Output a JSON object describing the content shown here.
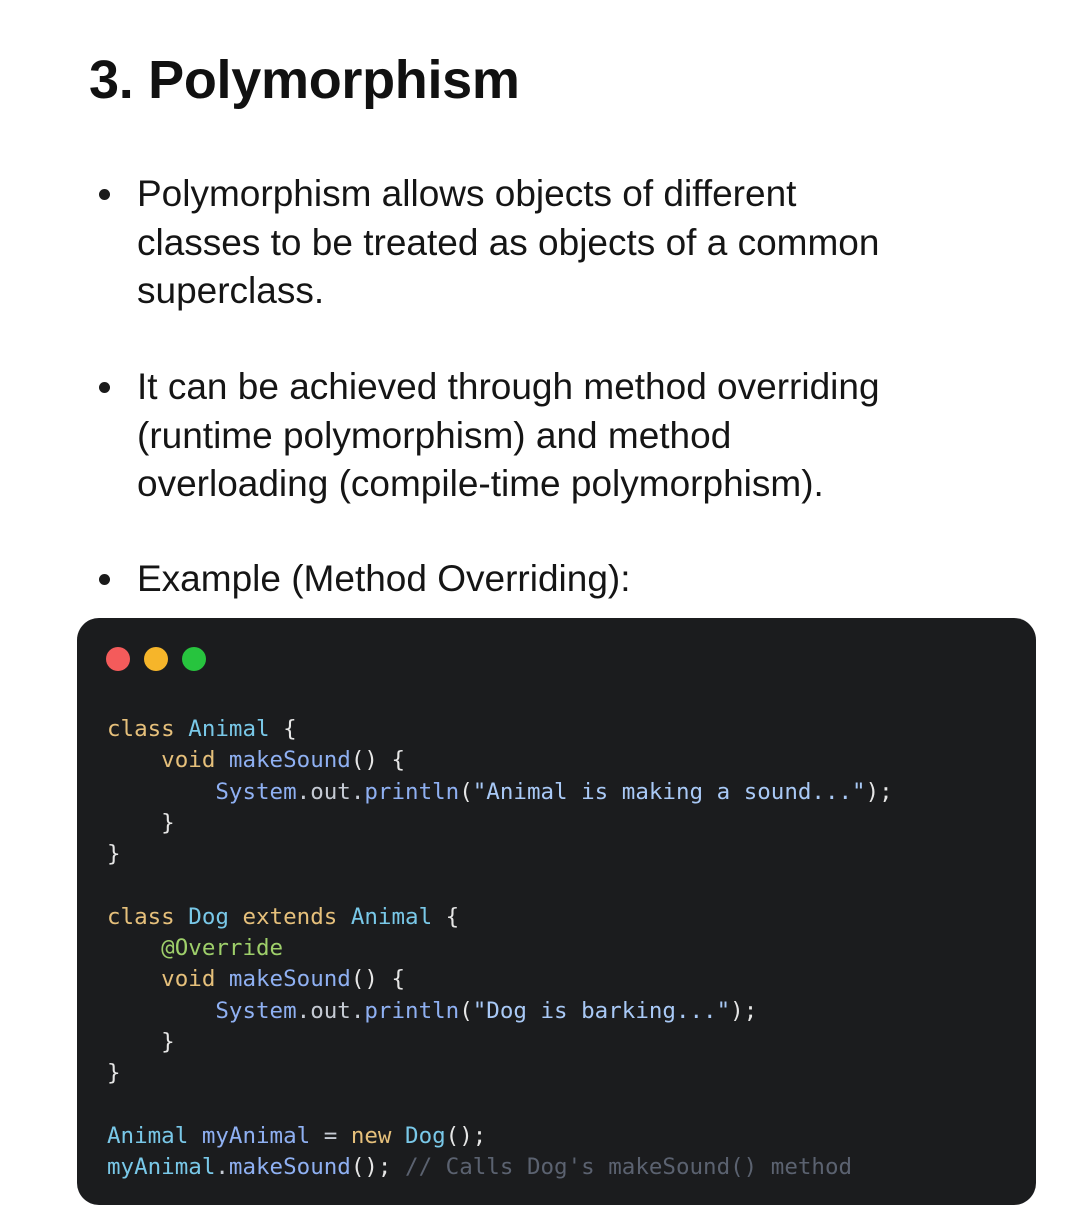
{
  "title": "3. Polymorphism",
  "bullets": [
    {
      "lines": [
        "Polymorphism allows objects of different",
        "classes to be treated as objects of a common",
        "superclass."
      ]
    },
    {
      "lines": [
        "It can be achieved through method overriding",
        "(runtime polymorphism) and method",
        "overloading (compile-time polymorphism)."
      ]
    },
    {
      "lines": [
        "Example (Method Overriding):"
      ]
    }
  ],
  "window_controls": {
    "close_color": "#f45b5b",
    "minimize_color": "#f6b52a",
    "maximize_color": "#27c43e"
  },
  "code": {
    "language": "java",
    "lines": [
      [
        {
          "t": "class ",
          "c": "kw"
        },
        {
          "t": "Animal ",
          "c": "ty"
        },
        {
          "t": "{",
          "c": "br"
        }
      ],
      [
        {
          "t": "    void ",
          "c": "kw"
        },
        {
          "t": "makeSound",
          "c": "fn"
        },
        {
          "t": "() {",
          "c": "br"
        }
      ],
      [
        {
          "t": "        System",
          "c": "fn"
        },
        {
          "t": ".out.",
          "c": "op"
        },
        {
          "t": "println",
          "c": "fn"
        },
        {
          "t": "(",
          "c": "br"
        },
        {
          "t": "\"Animal is making a sound...\"",
          "c": "st"
        },
        {
          "t": ");",
          "c": "br"
        }
      ],
      [
        {
          "t": "    }",
          "c": "br"
        }
      ],
      [
        {
          "t": "}",
          "c": "br"
        }
      ],
      [],
      [
        {
          "t": "class ",
          "c": "kw"
        },
        {
          "t": "Dog ",
          "c": "ty"
        },
        {
          "t": "extends ",
          "c": "kw"
        },
        {
          "t": "Animal ",
          "c": "ty"
        },
        {
          "t": "{",
          "c": "br"
        }
      ],
      [
        {
          "t": "    @Override",
          "c": "an"
        }
      ],
      [
        {
          "t": "    void ",
          "c": "kw"
        },
        {
          "t": "makeSound",
          "c": "fn"
        },
        {
          "t": "() {",
          "c": "br"
        }
      ],
      [
        {
          "t": "        System",
          "c": "fn"
        },
        {
          "t": ".out.",
          "c": "op"
        },
        {
          "t": "println",
          "c": "fn"
        },
        {
          "t": "(",
          "c": "br"
        },
        {
          "t": "\"Dog is barking...\"",
          "c": "st"
        },
        {
          "t": ");",
          "c": "br"
        }
      ],
      [
        {
          "t": "    }",
          "c": "br"
        }
      ],
      [
        {
          "t": "}",
          "c": "br"
        }
      ],
      [],
      [
        {
          "t": "Animal ",
          "c": "ty"
        },
        {
          "t": "myAnimal ",
          "c": "fn"
        },
        {
          "t": "= ",
          "c": "op"
        },
        {
          "t": "new ",
          "c": "kw"
        },
        {
          "t": "Dog",
          "c": "ty"
        },
        {
          "t": "();",
          "c": "br"
        }
      ],
      [
        {
          "t": "myAnimal",
          "c": "ty"
        },
        {
          "t": ".",
          "c": "op"
        },
        {
          "t": "makeSound",
          "c": "fn"
        },
        {
          "t": "(); ",
          "c": "br"
        },
        {
          "t": "// Calls Dog's makeSound() method",
          "c": "cm"
        }
      ]
    ]
  }
}
